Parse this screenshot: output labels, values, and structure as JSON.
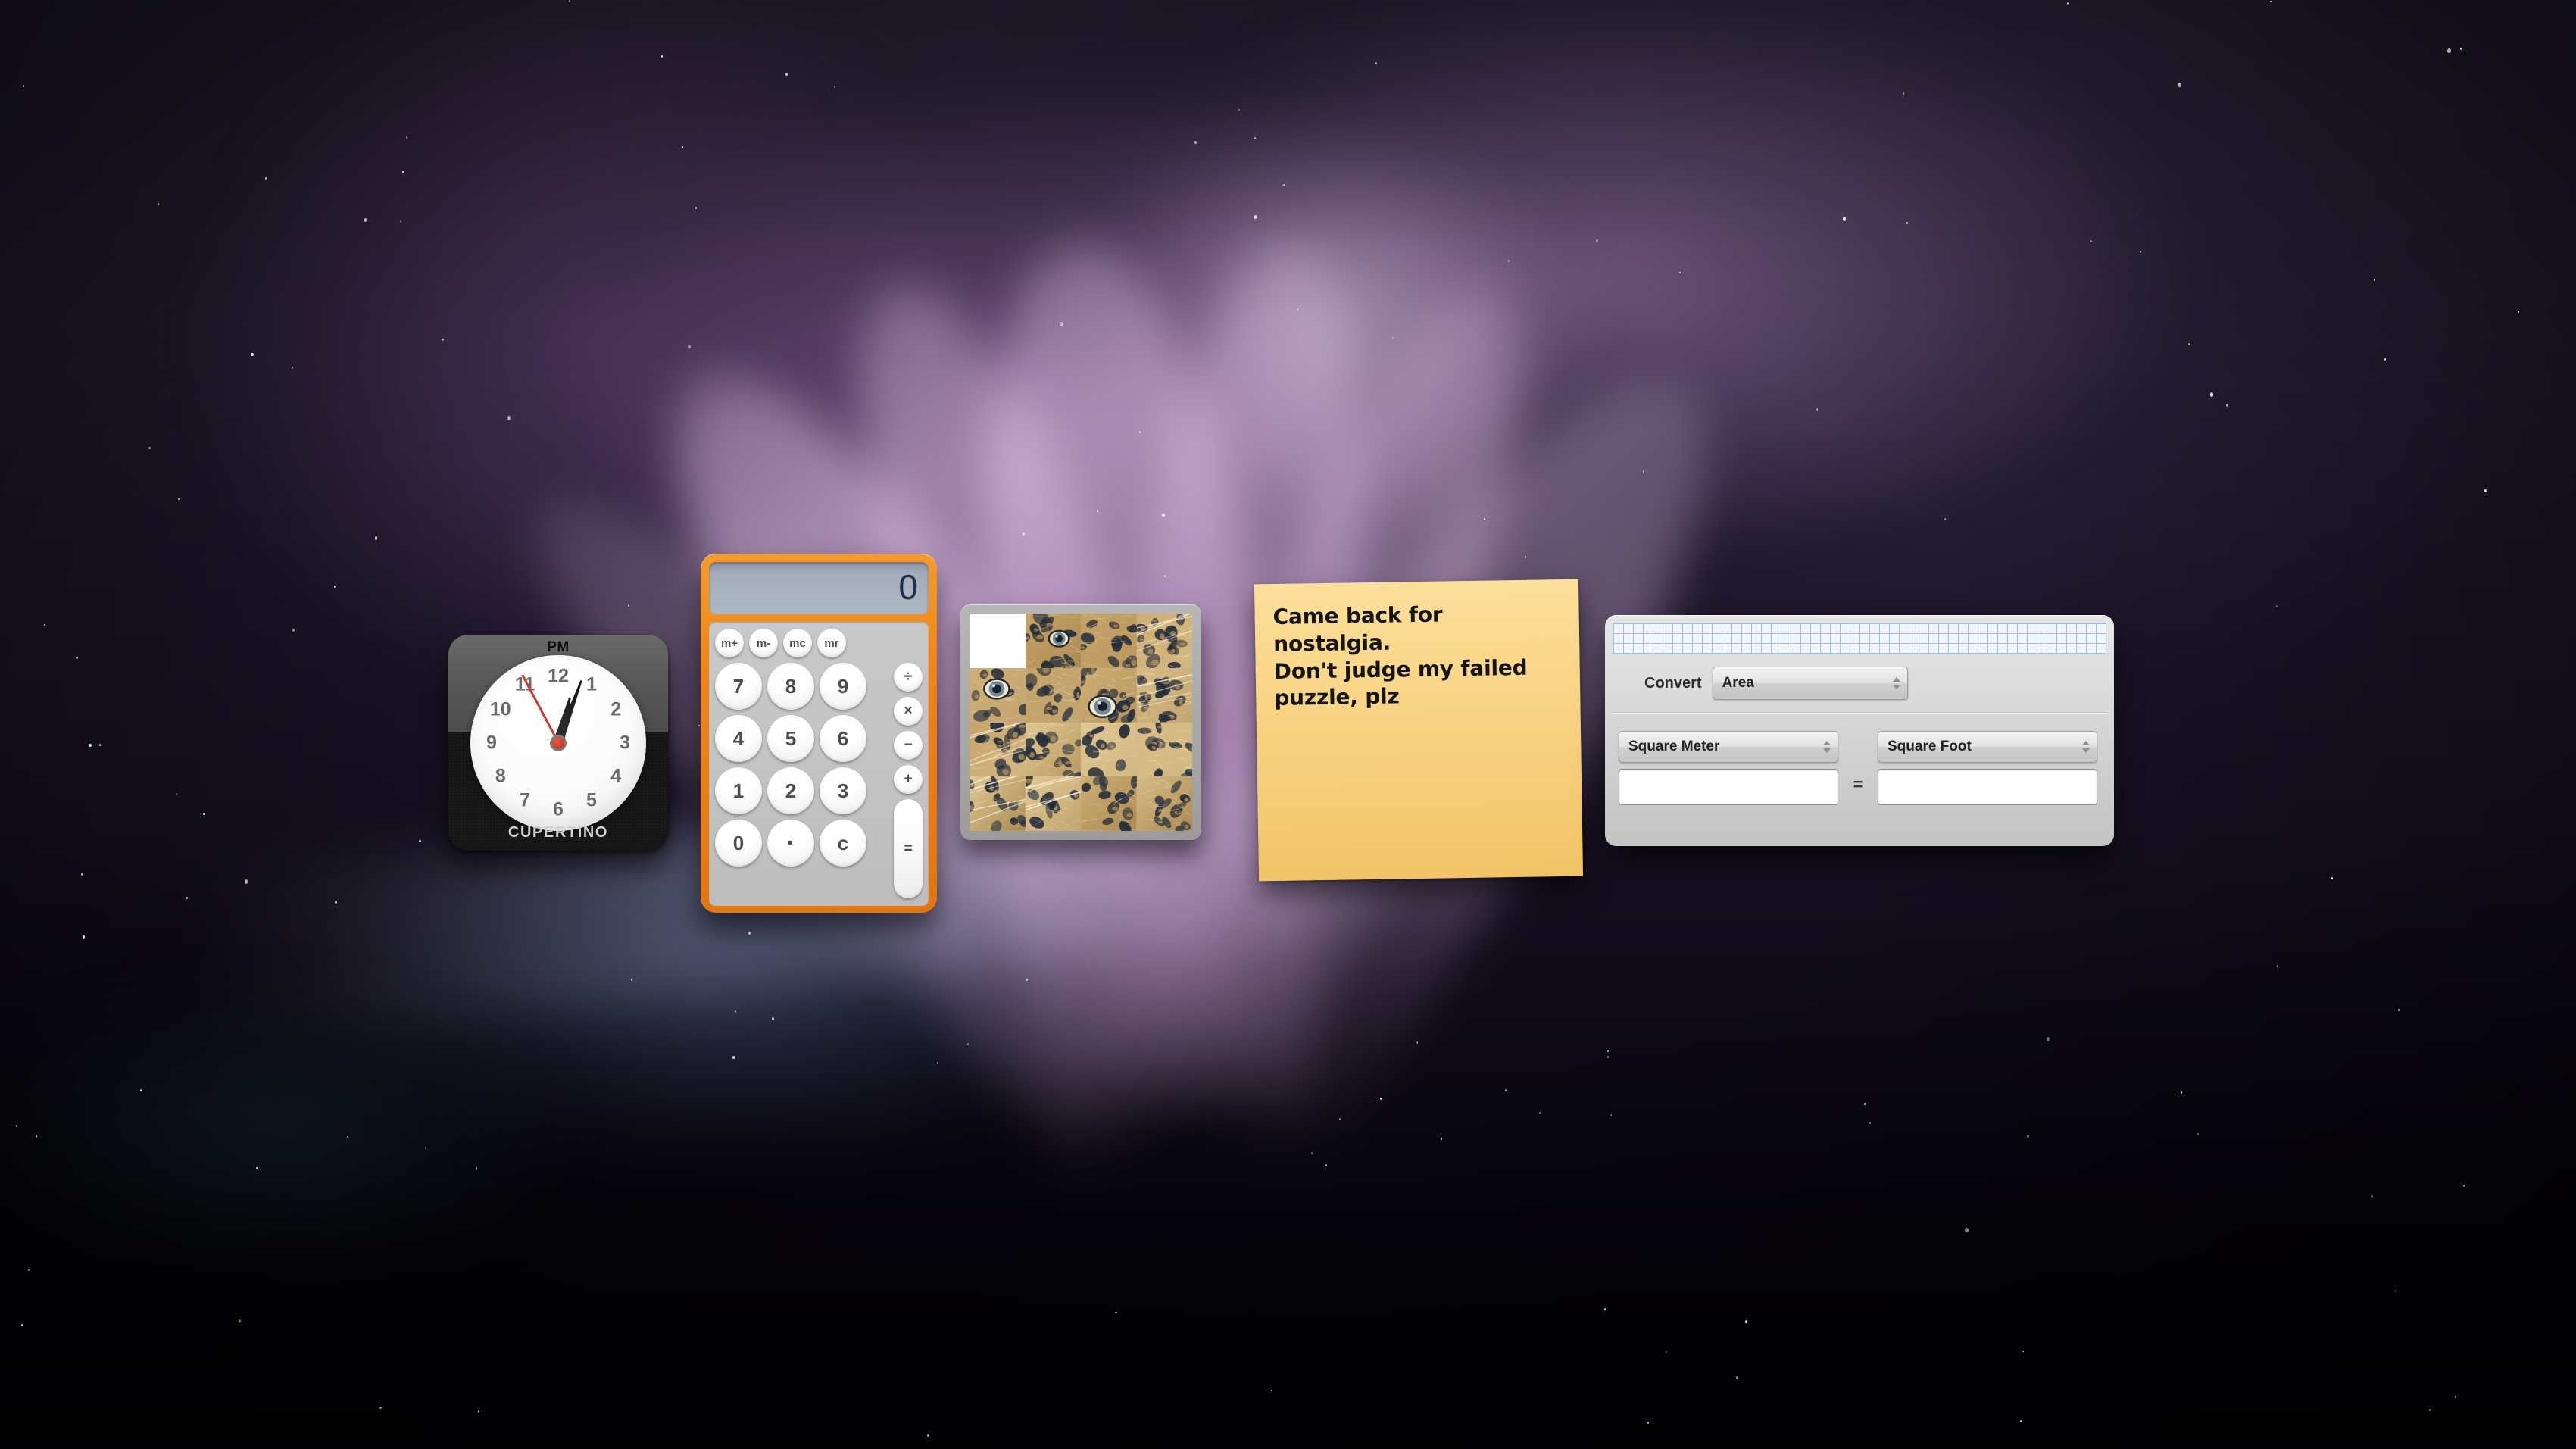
{
  "desktop": {
    "name": "macOS Dashboard",
    "wallpaper_name": "aurora-space-wallpaper",
    "colors": {
      "aurora_purple": "#b078be",
      "aurora_light": "#ecdaf0",
      "aurora_blue": "#7e96c8",
      "aurora_teal": "#469aa5",
      "sky_dark": "#0b0712"
    }
  },
  "widgets": {
    "clock": {
      "name": "World Clock",
      "ampm": "PM",
      "city": "CUPERTINO",
      "numerals": [
        "12",
        "1",
        "2",
        "3",
        "4",
        "5",
        "6",
        "7",
        "8",
        "9",
        "10",
        "11"
      ],
      "hand_angles": {
        "hour": 14,
        "minute": 20,
        "second": 332
      },
      "colors": {
        "second_hand": "#d03b2e",
        "face": "#ffffff",
        "case_top": "#565656",
        "case_bottom": "#161616"
      }
    },
    "calculator": {
      "name": "Calculator",
      "display_value": "0",
      "memory_keys": [
        "m+",
        "m-",
        "mc",
        "mr"
      ],
      "number_keys": [
        "7",
        "8",
        "9",
        "4",
        "5",
        "6",
        "1",
        "2",
        "3",
        "0",
        ".",
        "c"
      ],
      "operator_keys": [
        "÷",
        "×",
        "−",
        "+"
      ],
      "equals_key": "=",
      "colors": {
        "bezel": "#ef8418",
        "display": "#a3acb8",
        "display_text": "#1e3048"
      }
    },
    "puzzle": {
      "name": "Tile Game",
      "rows": 4,
      "columns": 4,
      "empty_tile_index": 0,
      "image_subject": "leopard",
      "tiles": [
        {
          "index": 0,
          "empty": true,
          "src_col": 0,
          "src_row": 0
        },
        {
          "index": 1,
          "empty": false,
          "src_col": 3,
          "src_row": 0
        },
        {
          "index": 2,
          "empty": false,
          "src_col": 1,
          "src_row": 2
        },
        {
          "index": 3,
          "empty": false,
          "src_col": 2,
          "src_row": 3
        },
        {
          "index": 4,
          "empty": false,
          "src_col": 0,
          "src_row": 1
        },
        {
          "index": 5,
          "empty": false,
          "src_col": 2,
          "src_row": 1
        },
        {
          "index": 6,
          "empty": false,
          "src_col": 3,
          "src_row": 2
        },
        {
          "index": 7,
          "empty": false,
          "src_col": 1,
          "src_row": 3
        },
        {
          "index": 8,
          "empty": false,
          "src_col": 0,
          "src_row": 3
        },
        {
          "index": 9,
          "empty": false,
          "src_col": 2,
          "src_row": 0
        },
        {
          "index": 10,
          "empty": false,
          "src_col": 1,
          "src_row": 1
        },
        {
          "index": 11,
          "empty": false,
          "src_col": 3,
          "src_row": 1
        },
        {
          "index": 12,
          "empty": false,
          "src_col": 0,
          "src_row": 2
        },
        {
          "index": 13,
          "empty": false,
          "src_col": 3,
          "src_row": 3
        },
        {
          "index": 14,
          "empty": false,
          "src_col": 1,
          "src_row": 0
        },
        {
          "index": 15,
          "empty": false,
          "src_col": 2,
          "src_row": 2
        }
      ],
      "colors": {
        "frame": "#9c9c9c",
        "empty_tile": "#ffffff"
      }
    },
    "stickies": {
      "name": "Stickies",
      "text": "Came back for nostalgia.\nDon't judge my failed\npuzzle, plz",
      "colors": {
        "paper": "#f8d383",
        "ink": "#141414"
      }
    },
    "converter": {
      "name": "Unit Converter",
      "convert_label": "Convert",
      "category": "Area",
      "from_unit": "Square Meter",
      "to_unit": "Square Foot",
      "from_value": "",
      "to_value": "",
      "equals_symbol": "=",
      "colors": {
        "grid_line": "#9dc0dd",
        "panel": "#d8d8d8"
      }
    }
  }
}
